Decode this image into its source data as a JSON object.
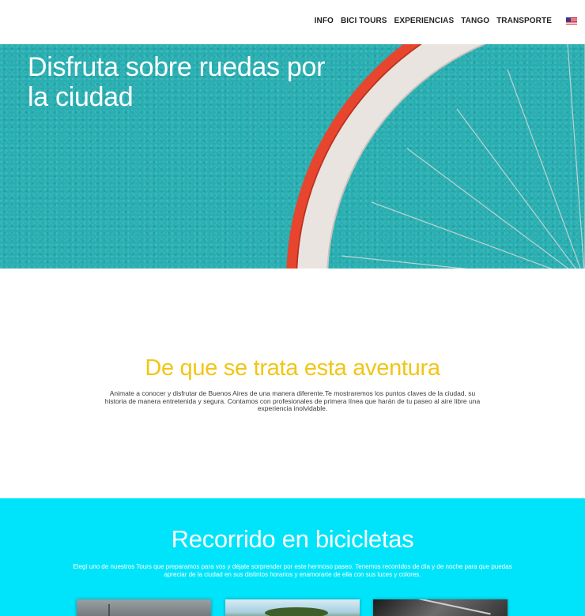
{
  "nav": {
    "items": [
      "INFO",
      "BICI TOURS",
      "EXPERIENCIAS",
      "TANGO",
      "TRANSPORTE"
    ],
    "language_flag": "us-flag-icon"
  },
  "hero": {
    "title": "Disfruta sobre ruedas por la ciudad"
  },
  "about": {
    "title": "De que se trata esta aventura",
    "text": "Animate a conocer y disfrutar de Buenos Aires de una manera diferente.Te mostraremos los puntos claves de la ciudad, su historia de manera entretenida y segura. Contamos con profesionales de primera línea que harán de tu paseo al aire libre una experiencia inolvidable."
  },
  "tours": {
    "title": "Recorrido en bicicletas",
    "text": "Elegí uno de nuestros Tours que preparamos para vos y déjate sorprender por este hermoso paseo. Tenemos recorridos de día y de noche para que puedas apreciar de la ciudad en sus distintos horarios y enamorarte de ella con sus luces y colores."
  },
  "colors": {
    "hero_bg": "#27aeb1",
    "about_title": "#f2c515",
    "tours_bg": "#00e4fb",
    "tire_red": "#e8452f"
  }
}
